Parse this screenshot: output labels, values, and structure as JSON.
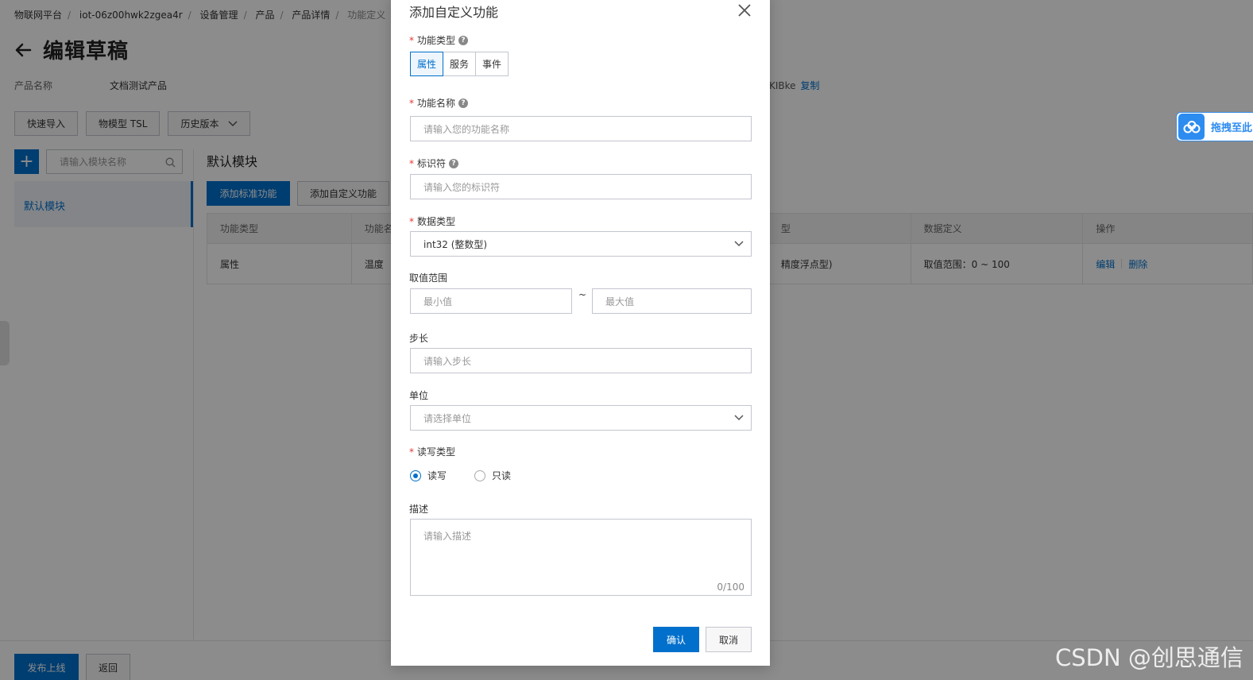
{
  "breadcrumb": {
    "items": [
      "物联网平台",
      "iot-06z00hwk2zgea4r",
      "设备管理",
      "产品",
      "产品详情"
    ],
    "current": "功能定义"
  },
  "page": {
    "title": "编辑草稿",
    "product_name_label": "产品名称",
    "product_name_value": "文档测试产品",
    "product_key_fragment": "KIBke",
    "copy_link": "复制"
  },
  "toolbar": {
    "quick_import": "快速导入",
    "tsl": "物模型 TSL",
    "history": "历史版本"
  },
  "sidebar": {
    "add_button": "+",
    "search_placeholder": "请输入模块名称",
    "items": [
      {
        "label": "默认模块"
      }
    ]
  },
  "main": {
    "module_title": "默认模块",
    "add_standard": "添加标准功能",
    "add_custom": "添加自定义功能"
  },
  "table": {
    "headers": [
      "功能类型",
      "功能名",
      "型",
      "数据定义",
      "操作"
    ],
    "rows": [
      {
        "type": "属性",
        "name": "温度",
        "data_type": "精度浮点型)",
        "definition": "取值范围：0 ~ 100",
        "edit": "编辑",
        "delete": "删除"
      }
    ]
  },
  "footer": {
    "publish": "发布上线",
    "back": "返回"
  },
  "float_widget": {
    "label": "拖拽至此"
  },
  "watermark": "CSDN @创思通信",
  "dialog": {
    "title": "添加自定义功能",
    "feature_type": {
      "label": "功能类型",
      "options": [
        "属性",
        "服务",
        "事件"
      ],
      "selected": "属性"
    },
    "feature_name": {
      "label": "功能名称",
      "placeholder": "请输入您的功能名称"
    },
    "identifier": {
      "label": "标识符",
      "placeholder": "请输入您的标识符"
    },
    "data_type": {
      "label": "数据类型",
      "value": "int32 (整数型)"
    },
    "range": {
      "label": "取值范围",
      "min_placeholder": "最小值",
      "separator": "~",
      "max_placeholder": "最大值"
    },
    "step": {
      "label": "步长",
      "placeholder": "请输入步长"
    },
    "unit": {
      "label": "单位",
      "placeholder": "请选择单位"
    },
    "rw_type": {
      "label": "读写类型",
      "options": [
        "读写",
        "只读"
      ],
      "selected": "读写"
    },
    "description": {
      "label": "描述",
      "placeholder": "请输入描述",
      "counter": "0/100"
    },
    "confirm": "确认",
    "cancel": "取消"
  },
  "colors": {
    "primary": "#0070cc",
    "required": "#e63737",
    "float_accent": "#2d8cf0"
  }
}
